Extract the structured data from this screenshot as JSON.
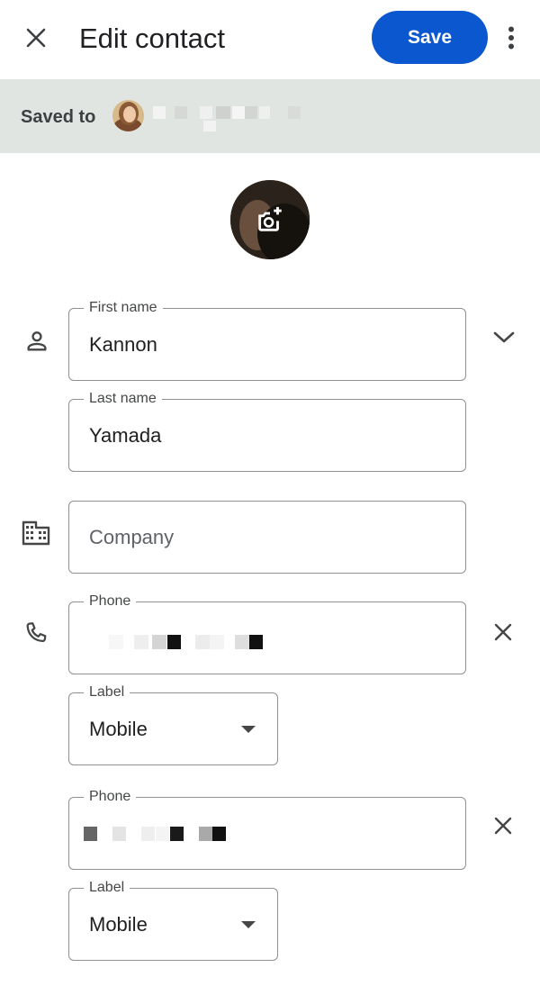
{
  "header": {
    "title": "Edit contact",
    "save_label": "Save"
  },
  "saved_to": {
    "label": "Saved to"
  },
  "fields": {
    "first_name": {
      "label": "First name",
      "value": "Kannon"
    },
    "last_name": {
      "label": "Last name",
      "value": "Yamada"
    },
    "company": {
      "placeholder": "Company"
    },
    "phones": [
      {
        "label": "Phone",
        "type_label": "Label",
        "type_value": "Mobile"
      },
      {
        "label": "Phone",
        "type_label": "Label",
        "type_value": "Mobile"
      }
    ]
  },
  "colors": {
    "accent": "#0b57d0",
    "saved_bar_bg": "#e1e5e1",
    "outline": "#8e918f",
    "icon": "#444746"
  },
  "icons": {
    "close": "close-icon",
    "more": "more-vert-icon",
    "camera": "add-photo-icon",
    "person": "person-icon",
    "company": "business-icon",
    "phone": "phone-icon",
    "expand": "chevron-down-icon",
    "remove": "close-icon",
    "dropdown": "arrow-drop-down-icon"
  }
}
